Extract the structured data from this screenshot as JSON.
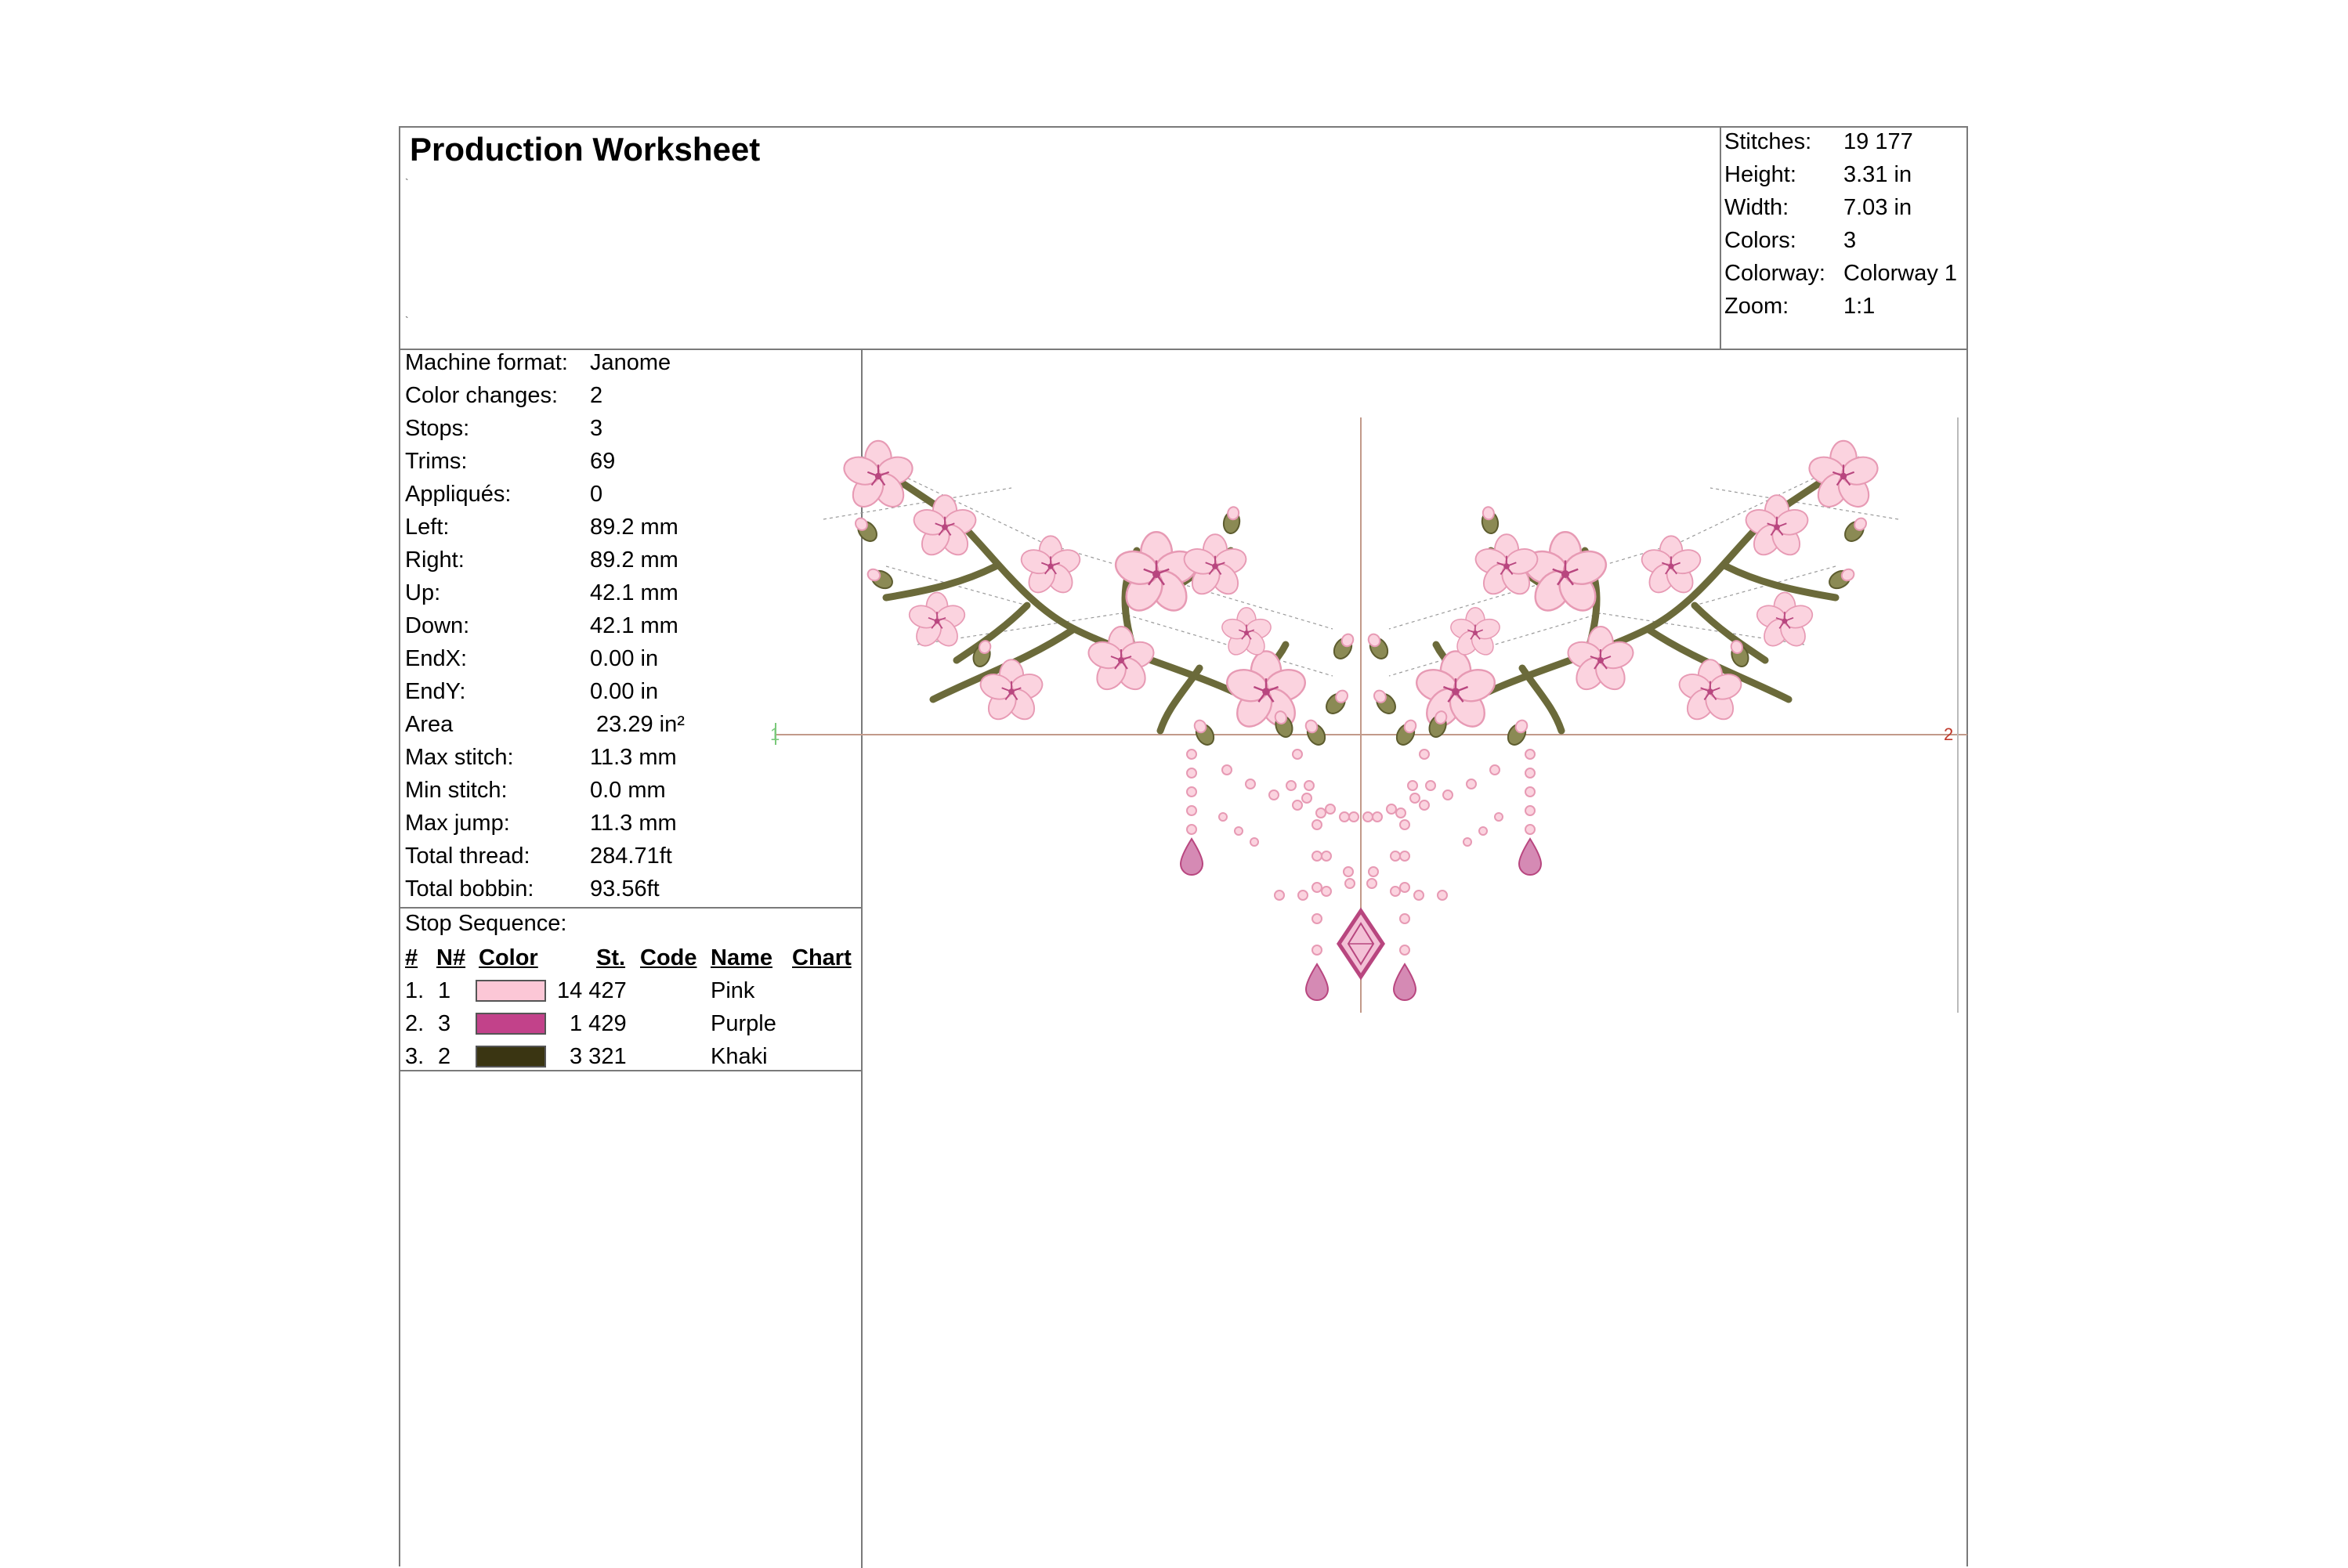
{
  "header": {
    "title": "Production Worksheet",
    "note1": "`",
    "note2": "`"
  },
  "summary": [
    {
      "label": "Stitches:",
      "value": "19 177"
    },
    {
      "label": "Height:",
      "value": "3.31 in"
    },
    {
      "label": "Width:",
      "value": "7.03 in"
    },
    {
      "label": "Colors:",
      "value": "3"
    },
    {
      "label": "Colorway:",
      "value": "Colorway 1"
    },
    {
      "label": "Zoom:",
      "value": "1:1"
    }
  ],
  "details": [
    {
      "label": "Machine format:",
      "value": "Janome"
    },
    {
      "label": "Color changes:",
      "value": "2"
    },
    {
      "label": "Stops:",
      "value": "3"
    },
    {
      "label": "Trims:",
      "value": "69"
    },
    {
      "label": "Appliqués:",
      "value": "0"
    },
    {
      "label": "Left:",
      "value": "89.2 mm"
    },
    {
      "label": "Right:",
      "value": "89.2 mm"
    },
    {
      "label": "Up:",
      "value": "42.1 mm"
    },
    {
      "label": "Down:",
      "value": "42.1 mm"
    },
    {
      "label": "EndX:",
      "value": "0.00 in"
    },
    {
      "label": "EndY:",
      "value": "0.00 in"
    },
    {
      "label": "Area",
      "value": " 23.29 in²"
    },
    {
      "label": "Max stitch:",
      "value": "11.3 mm"
    },
    {
      "label": "Min stitch:",
      "value": "0.0 mm"
    },
    {
      "label": "Max jump:",
      "value": "11.3 mm"
    },
    {
      "label": "Total thread:",
      "value": "284.71ft"
    },
    {
      "label": "Total bobbin:",
      "value": "93.56ft"
    }
  ],
  "stop_sequence": {
    "title": "Stop Sequence:",
    "headers": {
      "index": "#",
      "needle": "N#",
      "color": "Color",
      "stitches": "St.",
      "code": "Code",
      "name": "Name",
      "chart": "Chart"
    },
    "rows": [
      {
        "index": "1.",
        "needle": "1",
        "swatch": "#fcc7d6",
        "stitches": "14 427",
        "code": "",
        "name": "Pink",
        "chart": ""
      },
      {
        "index": "2.",
        "needle": "3",
        "swatch": "#c2428a",
        "stitches": "1 429",
        "code": "",
        "name": "Purple",
        "chart": ""
      },
      {
        "index": "3.",
        "needle": "2",
        "swatch": "#3a3512",
        "stitches": "3 321",
        "code": "",
        "name": "Khaki",
        "chart": ""
      }
    ]
  },
  "preview": {
    "axis_mark_left": "1",
    "axis_mark_right": "2",
    "thread_colors": {
      "pink": "#f9c9d8",
      "pink_outline": "#e79ab4",
      "purple": "#b8467f",
      "khaki": "#6b6a3a"
    }
  }
}
